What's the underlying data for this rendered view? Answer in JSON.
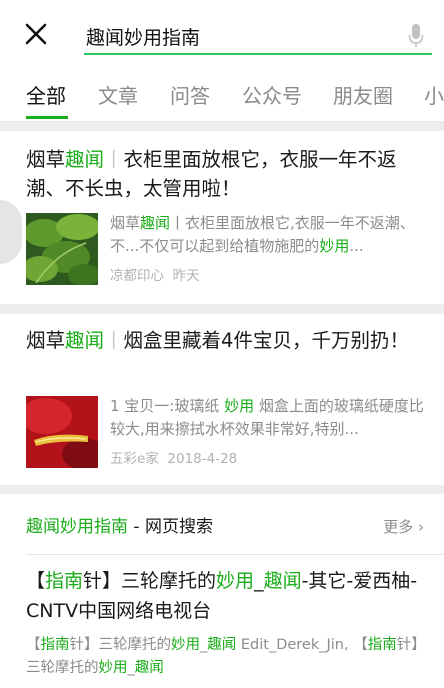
{
  "search": {
    "query": "趣闻妙用指南"
  },
  "tabs": [
    {
      "label": "全部",
      "active": true
    },
    {
      "label": "文章"
    },
    {
      "label": "问答"
    },
    {
      "label": "公众号"
    },
    {
      "label": "朋友圈"
    },
    {
      "label": "小"
    }
  ],
  "results": [
    {
      "title_a": "烟草",
      "title_hl": "趣闻",
      "title_sep": "丨",
      "title_b": "衣柜里面放根它，衣服一年不返潮、不长虫，太管用啦！",
      "snip_a": "烟草",
      "snip_hl": "趣闻",
      "snip_b": "丨衣柜里面放根它,衣服一年不返潮、不...不仅可以起到给植物施肥的",
      "snip_hl2": "妙用",
      "snip_c": "...",
      "source": "凉都印心",
      "time": "昨天",
      "thumb_icon": "green-plant-photo"
    },
    {
      "title_a": "烟草",
      "title_hl": "趣闻",
      "title_sep": "丨",
      "title_b": "烟盒里藏着4件宝贝，千万别扔！",
      "snip_a": "1 宝贝一:玻璃纸 ",
      "snip_hl": "妙用",
      "snip_b": " 烟盒上面的玻璃纸硬度比较大,用来擦拭水杯效果非常好,特别...",
      "source": "五彩e家",
      "time": "2018-4-28",
      "thumb_icon": "red-gold-photo"
    }
  ],
  "web": {
    "heading_hl": "趣闻妙用指南",
    "heading_rest": " - 网页搜索",
    "more": "更多",
    "title_p1": "【",
    "title_hl1": "指南",
    "title_p2": "针】三轮摩托的",
    "title_hl2": "妙用",
    "title_p3": "_",
    "title_hl3": "趣闻",
    "title_p4": "-其它-爱西柚-CNTV中国网络电视台",
    "snip_p1": "【",
    "snip_hl1": "指南",
    "snip_p2": "针】三轮摩托的",
    "snip_hl2": "妙用",
    "snip_p3": "_",
    "snip_hl3": "趣闻",
    "snip_p4": " Edit_Derek_Jin, 【",
    "snip_hl4": "指南",
    "snip_p5": "针】三轮摩托的",
    "snip_hl5": "妙用",
    "snip_p6": "_",
    "snip_hl6": "趣闻"
  },
  "colors": {
    "accent": "#1aad19",
    "muted": "#8c8c8c",
    "bg": "#ededed"
  }
}
